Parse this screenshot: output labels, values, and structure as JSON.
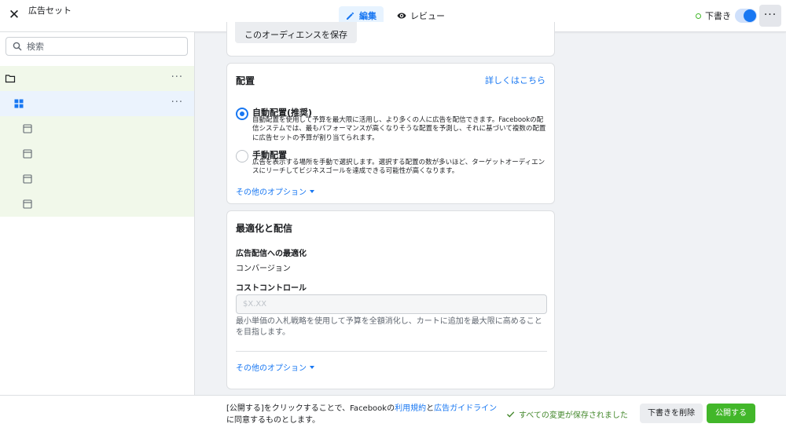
{
  "header": {
    "close_glyph": "✕",
    "title": "広告セット",
    "tabs": [
      {
        "label": "編集",
        "icon": "pencil-icon",
        "active": true
      },
      {
        "label": "レビュー",
        "icon": "eye-icon",
        "active": false
      }
    ],
    "draft_label": "下書き",
    "more_glyph": "···"
  },
  "sidebar": {
    "search_placeholder": "検索",
    "tree": [
      {
        "icon": "folder-icon",
        "level": 0,
        "more": "···"
      },
      {
        "icon": "grid-icon",
        "level": 1,
        "selected": true,
        "more": "···"
      },
      {
        "icon": "ad-icon",
        "level": 2
      },
      {
        "icon": "ad-icon",
        "level": 2
      },
      {
        "icon": "ad-icon",
        "level": 2
      },
      {
        "icon": "ad-icon",
        "level": 2
      }
    ]
  },
  "audience": {
    "save_button": "このオーディエンスを保存"
  },
  "placements": {
    "title": "配置",
    "learn_more": "詳しくはこちら",
    "auto": {
      "label": "自動配置(推奨)",
      "description": "自動配置を使用して予算を最大限に活用し、より多くの人に広告を配信できます。Facebookの配信システムでは、最もパフォーマンスが高くなりそうな配置を予測し、それに基づいて複数の配置に広告セットの予算が割り当てられます。"
    },
    "manual": {
      "label": "手動配置",
      "description": "広告を表示する場所を手動で選択します。選択する配置の数が多いほど、ターゲットオーディエンスにリーチしてビジネスゴールを達成できる可能性が高くなります。"
    },
    "more_options": "その他のオプション"
  },
  "optimization": {
    "title": "最適化と配信",
    "delivery_label": "広告配信への最適化",
    "delivery_value": "コンバージョン",
    "cost_label": "コストコントロール",
    "cost_placeholder": "$X.XX",
    "help": "最小単価の入札戦略を使用して予算を全額消化し、カートに追加を最大限に高めることを目指します。",
    "more_options": "その他のオプション"
  },
  "footer": {
    "terms_prefix": "[公開する]をクリックすることで、Facebookの",
    "terms_link1": "利用規約",
    "terms_and": "と",
    "terms_link2": "広告ガイドライン",
    "terms_suffix": "に同意するものとします。",
    "saved": "すべての変更が保存されました",
    "delete_draft": "下書きを削除",
    "publish": "公開する"
  },
  "colors": {
    "accent": "#1877f2",
    "success": "#42b72a",
    "tree_bg": "#f1f8ea",
    "tree_selected_bg": "#ebf3fd"
  }
}
